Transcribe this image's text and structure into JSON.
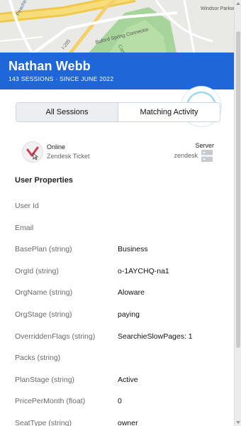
{
  "map": {
    "labels": [
      "Peachtree Dunwoody Rd",
      "I-285",
      "Buford Spring Connector",
      "Camino",
      "Windsor Parkway"
    ]
  },
  "header": {
    "name": "Nathan Webb",
    "subtitle": "143 SESSIONS · SINCE JUNE 2022",
    "color": "#1f66d8"
  },
  "tabs": [
    {
      "label": "All Sessions",
      "active": false
    },
    {
      "label": "Matching Activity",
      "active": true
    }
  ],
  "status": {
    "state": "Online",
    "source": "Zendesk Ticket",
    "side_label": "Server",
    "side_value": "zendesk",
    "icon": "zendesk-check-icon",
    "server_icon": "server-icon"
  },
  "user_properties": {
    "title": "User Properties",
    "rows": [
      {
        "key": "User Id",
        "value": ""
      },
      {
        "key": "Email",
        "value": ""
      },
      {
        "key": "BasePlan (string)",
        "value": "Business"
      },
      {
        "key": "OrgId (string)",
        "value": "o-1AYCHQ-na1"
      },
      {
        "key": "OrgName (string)",
        "value": "Aloware"
      },
      {
        "key": "OrgStage (string)",
        "value": "paying"
      },
      {
        "key": "OverriddenFlags (string)",
        "value": "SearchieSlowPages: 1"
      },
      {
        "key": "Packs (string)",
        "value": ""
      },
      {
        "key": "PlanStage (string)",
        "value": "Active"
      },
      {
        "key": "PricePerMonth (float)",
        "value": "0"
      },
      {
        "key": "SeatType (string)",
        "value": "owner"
      }
    ]
  }
}
